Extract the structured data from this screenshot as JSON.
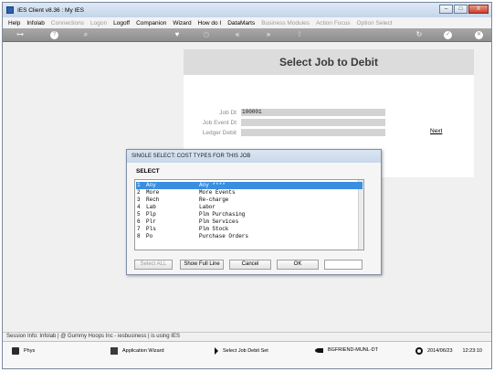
{
  "window": {
    "title": "IES Client v8.36 : My IES",
    "min_label": "–",
    "max_label": "□",
    "close_label": "X"
  },
  "menu": {
    "help": "Help",
    "infolab": "Infolab",
    "connections": "Connections",
    "logon": "Logon",
    "logoff": "Logoff",
    "companion": "Companion",
    "wizard": "Wizard",
    "howdoi": "How do I",
    "datamarts": "DataMarts",
    "business_modules": "Business Modules",
    "action_focus": "Action Focus",
    "option_select": "Option Select"
  },
  "toolbar": {
    "key": "⊶",
    "help": "?",
    "search": "⌕",
    "heart": "♥",
    "history": "◷",
    "back": "«",
    "forward": "»",
    "upload": "⇧",
    "refresh": "↻",
    "ok": "✓",
    "close": "✕"
  },
  "panel": {
    "title": "Select Job to Debit",
    "job_label": "Job Dt",
    "job_value": "100001",
    "event_label": "Job Event Dt",
    "ledger_label": "Ledger Debit",
    "next": "Next"
  },
  "dialog": {
    "title": "SINGLE SELECT: COST TYPES FOR THIS JOB",
    "header": "SELECT",
    "rows": [
      {
        "num": "1",
        "code": "Any",
        "desc": "Any ****"
      },
      {
        "num": "2",
        "code": "More",
        "desc": "More Events"
      },
      {
        "num": "3",
        "code": "Rech",
        "desc": "Re-charge"
      },
      {
        "num": "4",
        "code": "Lab",
        "desc": "Labor"
      },
      {
        "num": "5",
        "code": "Plp",
        "desc": "Plm Purchasing"
      },
      {
        "num": "6",
        "code": "Plr",
        "desc": "Plm Services"
      },
      {
        "num": "7",
        "code": "Pls",
        "desc": "Plm Stock"
      },
      {
        "num": "8",
        "code": "Po",
        "desc": "Purchase Orders"
      }
    ],
    "selected_row": 0,
    "buttons": {
      "select_all": "Select ALL",
      "show_full_line": "Show Full Line",
      "cancel": "Cancel",
      "ok": "OK"
    }
  },
  "session": "Session Info: Infolab | @ Gummy Hoops Inc - iesbusiness | is using IES",
  "status": {
    "phys": "Phys",
    "wizard": "Application Wizard",
    "step": "Select Job Debit Set",
    "user": "BGFRIEND-MUNL-DT",
    "date": "2014/06/23",
    "time": "12:23:10"
  },
  "colors": {
    "selection": "#3a8ee0",
    "toolbar": "#9a9a9a",
    "panel_header": "#dcdcdc"
  }
}
